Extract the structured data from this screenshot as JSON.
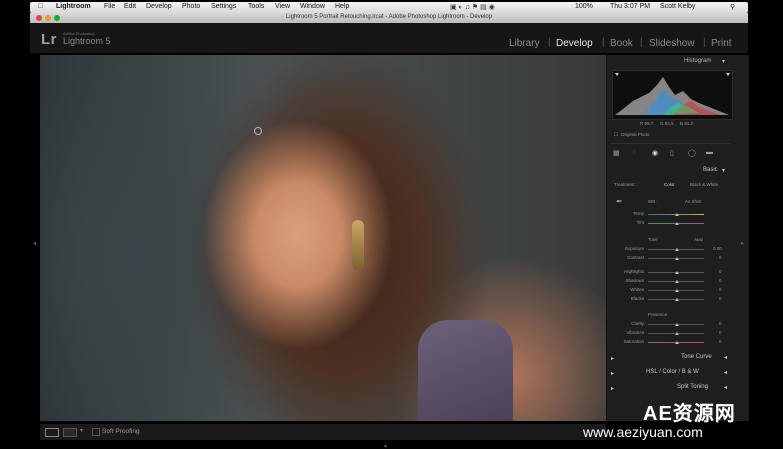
{
  "menubar": {
    "apple": "",
    "items": [
      "Lightroom",
      "File",
      "Edit",
      "Develop",
      "Photo",
      "Settings",
      "Tools",
      "View",
      "Window",
      "Help"
    ],
    "status": {
      "battery": "100%",
      "clock": "Thu 3:07 PM",
      "user": "Scott Kelby"
    }
  },
  "window": {
    "title": "Lightroom 5 Portrait Retouching.lrcat - Adobe Photoshop Lightroom - Develop"
  },
  "identity": {
    "logo": "Lr",
    "product": "Lightroom 5",
    "subtitle": "Adobe Photoshop"
  },
  "modules": [
    {
      "label": "Library",
      "active": false
    },
    {
      "label": "Develop",
      "active": true
    },
    {
      "label": "Book",
      "active": false
    },
    {
      "label": "Slideshow",
      "active": false
    },
    {
      "label": "Print",
      "active": false
    }
  ],
  "histogram": {
    "header": "Histogram",
    "readout": [
      "R 95.7",
      "G 92.5",
      "B 91.2"
    ],
    "original_photo": "Original Photo"
  },
  "basic": {
    "header": "Basic",
    "treatment": {
      "label": "Treatment :",
      "color": "Color",
      "bw": "Black & White"
    },
    "wb": {
      "label": "WB :",
      "value": "As Shot"
    },
    "temp": "Temp",
    "tint": "Tint",
    "tone": {
      "label": "Tone",
      "auto": "Auto"
    },
    "exposure": {
      "label": "Exposure",
      "value": "0.00"
    },
    "contrast": {
      "label": "Contrast",
      "value": "0"
    },
    "highlights": {
      "label": "Highlights",
      "value": "0"
    },
    "shadows": {
      "label": "Shadows",
      "value": "0"
    },
    "whites": {
      "label": "Whites",
      "value": "0"
    },
    "blacks": {
      "label": "Blacks",
      "value": "0"
    },
    "presence": "Presence",
    "clarity": {
      "label": "Clarity",
      "value": "0"
    },
    "vibrance": {
      "label": "Vibrance",
      "value": "0"
    },
    "saturation": {
      "label": "Saturation",
      "value": "0"
    }
  },
  "panels": {
    "tone_curve": "Tone Curve",
    "hsl": "HSL / Color / B & W",
    "split_toning": "Split Toning"
  },
  "toolbar": {
    "soft_proofing": "Soft Proofing"
  },
  "watermark": {
    "line1": "AE资源网",
    "line2": "www.aeziyuan.com"
  }
}
